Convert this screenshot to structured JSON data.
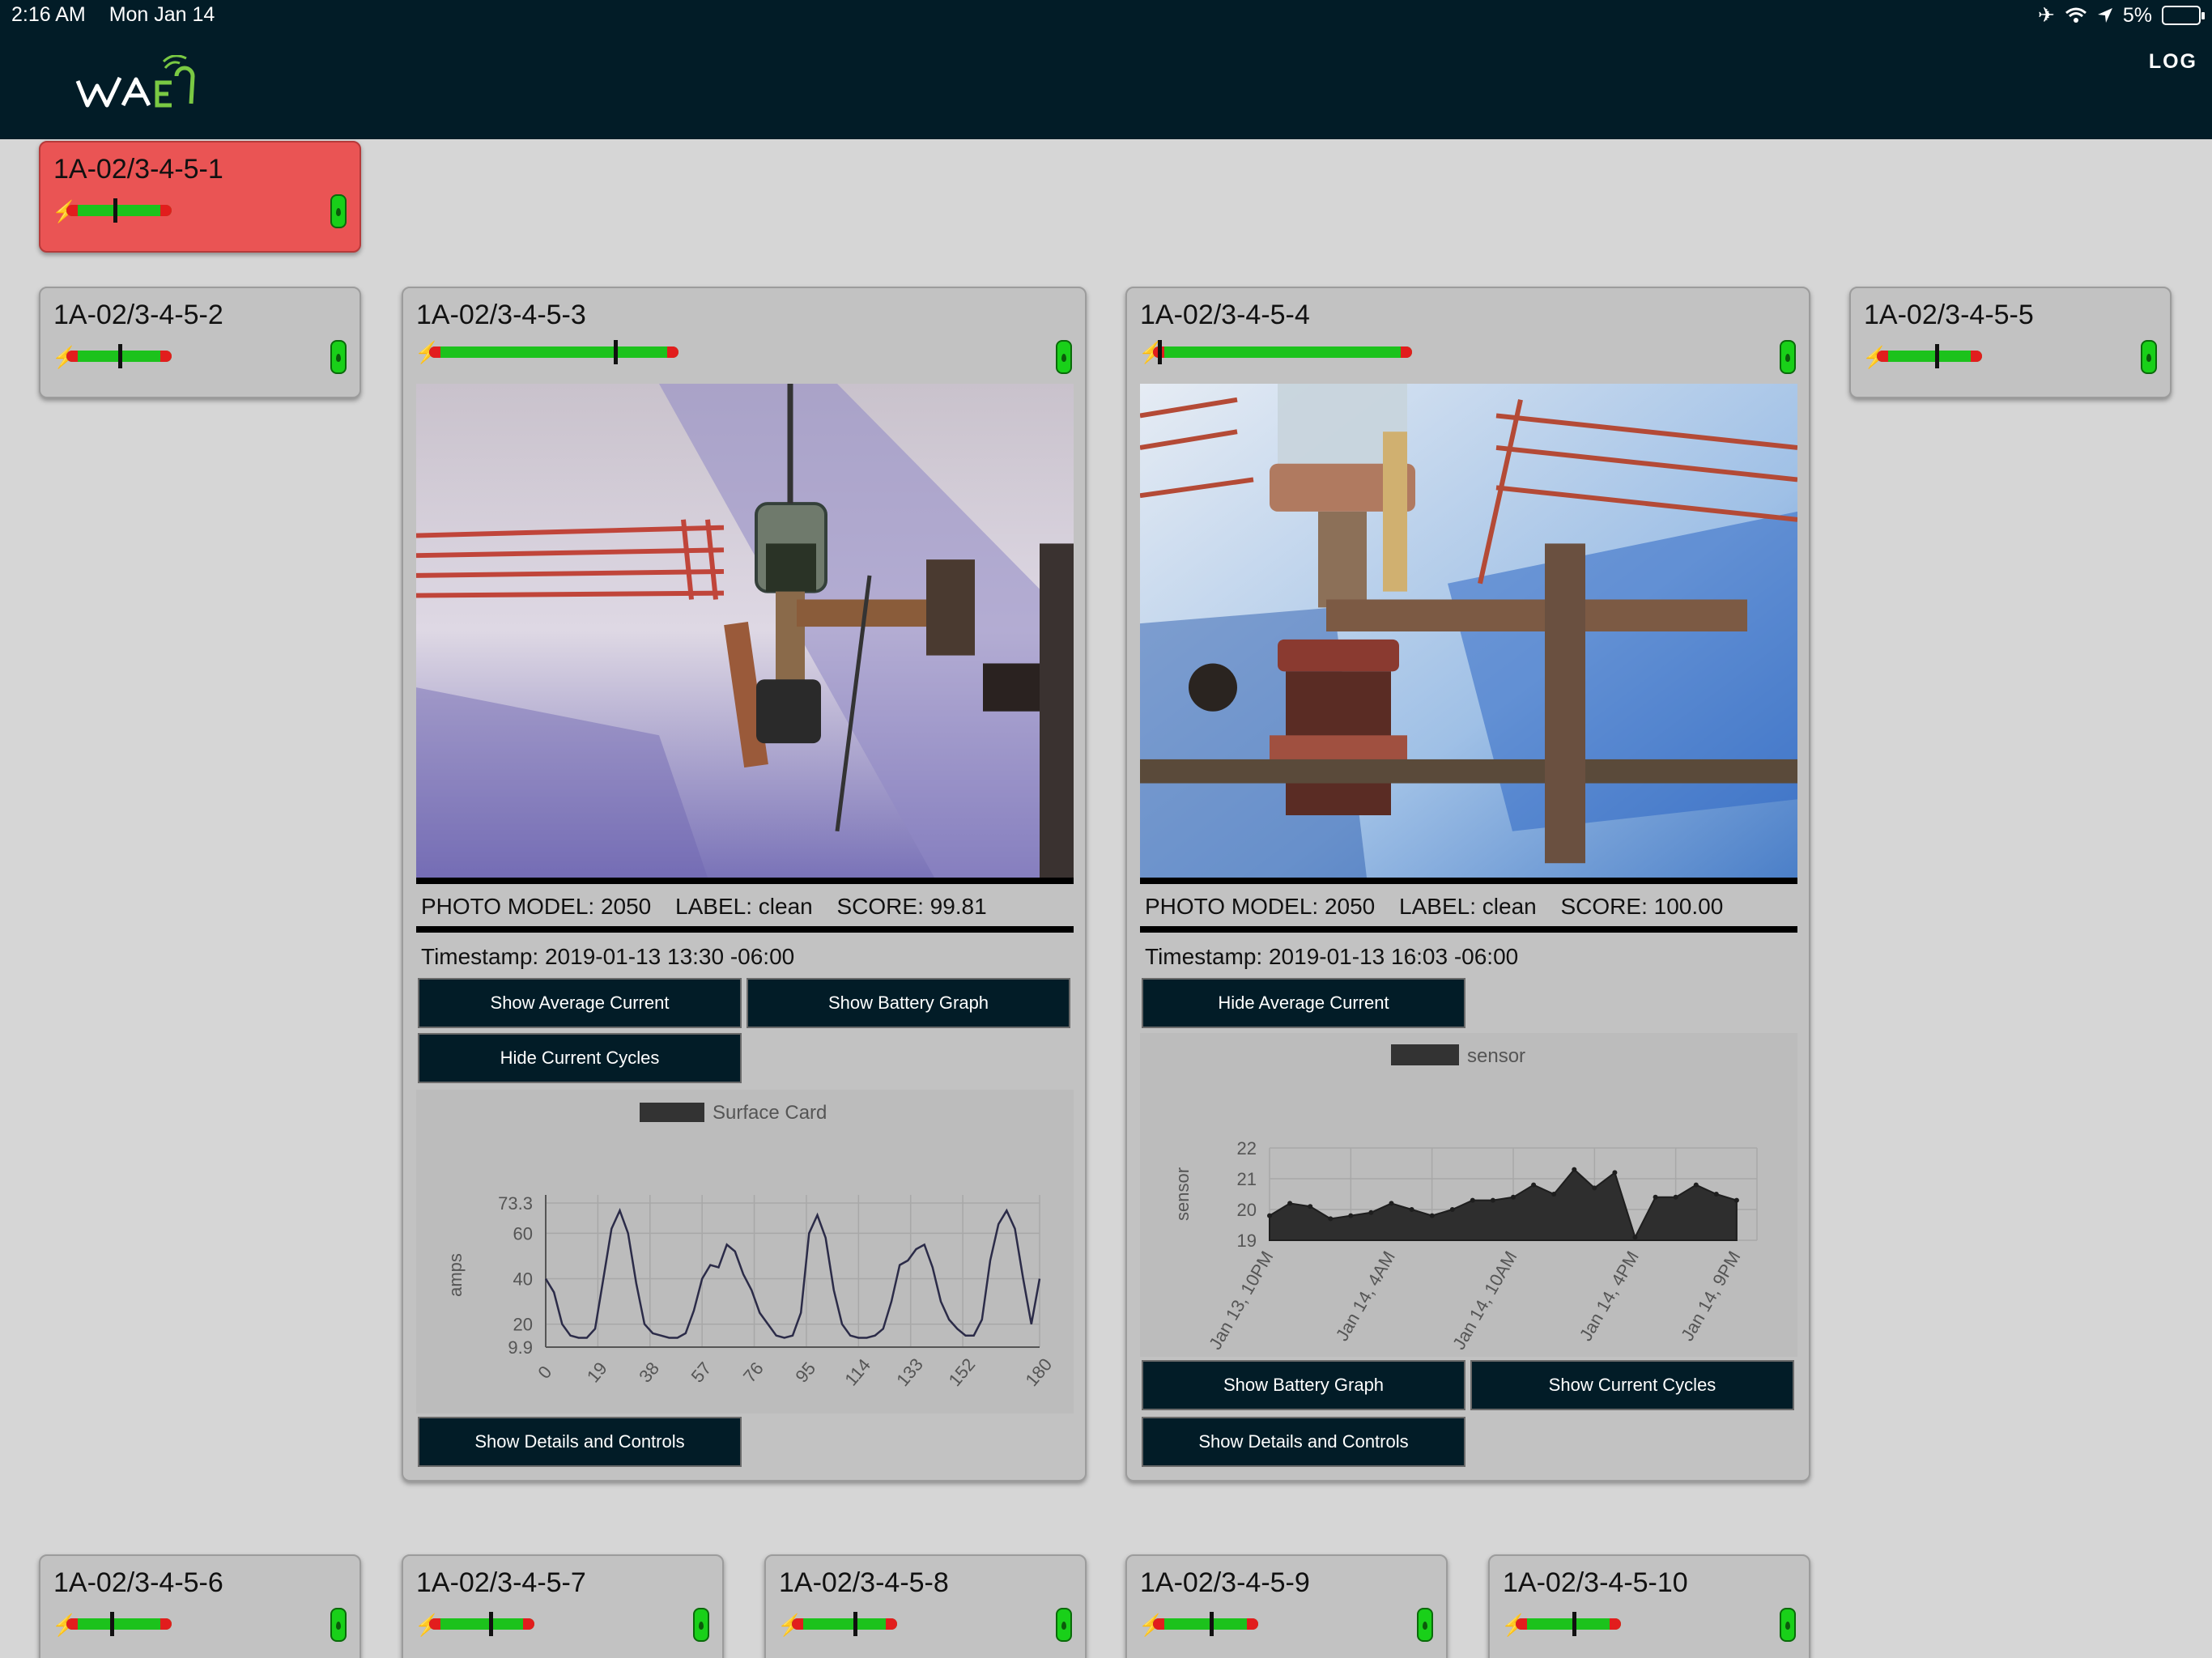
{
  "status_bar": {
    "time": "2:16 AM",
    "date": "Mon Jan 14",
    "battery": "5%"
  },
  "header": {
    "logo_text": "WAVE9",
    "log_label": "LOG"
  },
  "cards": {
    "c1": {
      "title": "1A-02/3-4-5-1",
      "level": 0.48,
      "state": "alert"
    },
    "c2": {
      "title": "1A-02/3-4-5-2",
      "level": 0.52
    },
    "c3": {
      "title": "1A-02/3-4-5-3",
      "level": 0.75,
      "photo_model": "PHOTO MODEL: 2050",
      "label": "LABEL: clean",
      "score": "SCORE: 99.81",
      "timestamp": "Timestamp: 2019-01-13 13:30 -06:00",
      "buttons": {
        "avg_current": "Show Average Current",
        "battery_graph": "Show Battery Graph",
        "current_cycles": "Hide Current Cycles",
        "details": "Show Details and Controls"
      }
    },
    "c4": {
      "title": "1A-02/3-4-5-4",
      "level": 0.02,
      "photo_model": "PHOTO MODEL: 2050",
      "label": "LABEL: clean",
      "score": "SCORE: 100.00",
      "timestamp": "Timestamp: 2019-01-13 16:03 -06:00",
      "buttons": {
        "avg_current": "Hide Average Current",
        "battery_graph": "Show Battery Graph",
        "current_cycles": "Show Current Cycles",
        "details": "Show Details and Controls"
      }
    },
    "c5": {
      "title": "1A-02/3-4-5-5",
      "level": 0.55
    },
    "c6": {
      "title": "1A-02/3-4-5-6",
      "level": 0.42
    },
    "c7": {
      "title": "1A-02/3-4-5-7",
      "level": 0.58
    },
    "c8": {
      "title": "1A-02/3-4-5-8",
      "level": 0.6
    },
    "c9": {
      "title": "1A-02/3-4-5-9",
      "level": 0.55
    },
    "c10": {
      "title": "1A-02/3-4-5-10",
      "level": 0.55
    }
  },
  "chart_data": [
    {
      "type": "line",
      "legend": "Surface Card",
      "ylabel": "amps",
      "yticks": [
        "73.3",
        "60",
        "40",
        "20",
        "9.9"
      ],
      "ytick_values": [
        73.3,
        60,
        40,
        20,
        9.9
      ],
      "ylim": [
        9.9,
        73.3
      ],
      "xticks": [
        "0",
        "19",
        "38",
        "57",
        "76",
        "95",
        "114",
        "133",
        "152",
        "180"
      ],
      "xtick_values": [
        0,
        19,
        38,
        57,
        76,
        95,
        114,
        133,
        152,
        180
      ],
      "xlim": [
        0,
        180
      ],
      "grid": true,
      "x": [
        0,
        3,
        6,
        9,
        12,
        15,
        18,
        21,
        24,
        27,
        30,
        33,
        36,
        39,
        42,
        45,
        48,
        51,
        54,
        57,
        60,
        63,
        66,
        69,
        72,
        75,
        78,
        81,
        84,
        87,
        90,
        93,
        96,
        99,
        102,
        105,
        108,
        111,
        114,
        117,
        120,
        123,
        126,
        129,
        132,
        135,
        138,
        141,
        144,
        147,
        150,
        153,
        156,
        159,
        162,
        165,
        168,
        171,
        174,
        177,
        180
      ],
      "y": [
        40,
        34,
        20,
        15,
        14,
        14,
        18,
        40,
        62,
        70,
        60,
        38,
        20,
        16,
        15,
        14,
        14,
        16,
        26,
        40,
        46,
        45,
        55,
        52,
        42,
        35,
        25,
        20,
        15,
        14,
        15,
        25,
        60,
        68,
        58,
        35,
        20,
        15,
        14,
        14,
        15,
        18,
        30,
        46,
        48,
        53,
        55,
        45,
        30,
        22,
        18,
        15,
        15,
        22,
        48,
        64,
        70,
        62,
        40,
        20,
        40
      ]
    },
    {
      "type": "area",
      "legend": "sensor",
      "ylabel": "sensor",
      "yticks": [
        "22",
        "21",
        "20",
        "19"
      ],
      "ytick_values": [
        22,
        21,
        20,
        19
      ],
      "ylim": [
        19,
        22
      ],
      "xticks": [
        "Jan 13, 10PM",
        "Jan 14, 4AM",
        "Jan 14, 10AM",
        "Jan 14, 4PM",
        "Jan 14, 9PM"
      ],
      "xtick_positions": [
        0,
        6,
        12,
        18,
        23
      ],
      "xlim": [
        0,
        24
      ],
      "grid": true,
      "values": [
        19.8,
        20.2,
        20.1,
        19.7,
        19.8,
        19.9,
        20.2,
        20.0,
        19.8,
        20.0,
        20.3,
        20.3,
        20.4,
        20.8,
        20.5,
        21.3,
        20.7,
        21.2,
        19.1,
        20.4,
        20.4,
        20.8,
        20.5,
        20.3
      ]
    }
  ]
}
